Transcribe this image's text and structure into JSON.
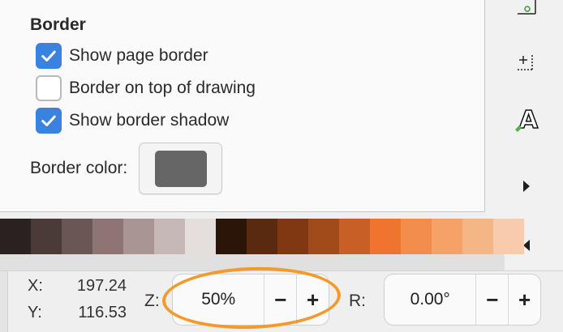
{
  "border": {
    "title": "Border",
    "options": [
      {
        "label": "Show page border",
        "checked": true
      },
      {
        "label": "Border on top of drawing",
        "checked": false
      },
      {
        "label": "Show border shadow",
        "checked": true
      }
    ],
    "color_label": "Border color:",
    "color_value": "#666666"
  },
  "toolbar": {
    "icons": [
      "snap-page-icon",
      "snap-guide-icon",
      "text-tool-icon",
      "expand-right-icon",
      "collapse-left-icon"
    ],
    "text_icon_glyph": "A"
  },
  "palette": [
    "#2a2220",
    "#4a3a38",
    "#6a5654",
    "#8e7472",
    "#a99694",
    "#c6b8b6",
    "#e4dedd",
    "#2a1508",
    "#5a2a10",
    "#7f3812",
    "#a14a1a",
    "#c85f26",
    "#ef7430",
    "#f28d4e",
    "#f5a168",
    "#f5b686",
    "#f7cbac"
  ],
  "status": {
    "x_label": "X:",
    "x_value": "197.24",
    "y_label": "Y:",
    "y_value": "116.53",
    "zoom_label": "Z:",
    "zoom_value": "50%",
    "rotation_label": "R:",
    "rotation_value": "0.00°",
    "minus": "−",
    "plus": "+"
  },
  "annotation_color": "#f39a2d",
  "accent": "#3b82e0"
}
